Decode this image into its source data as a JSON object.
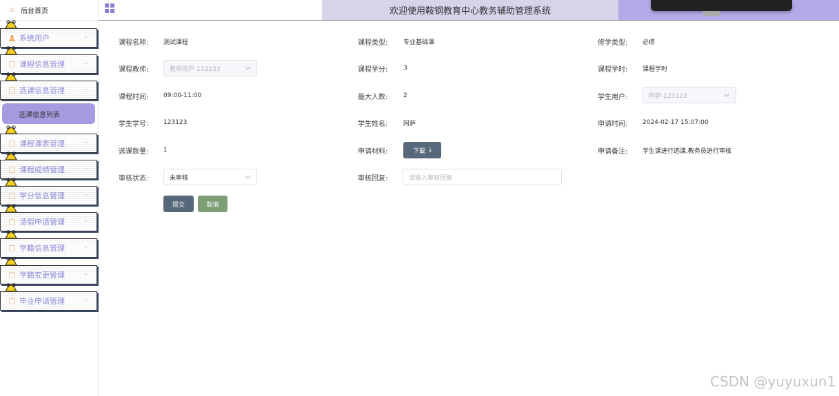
{
  "sidebar": {
    "home_label": "后台首页",
    "items": [
      {
        "label": "系统用户",
        "icon": "user-icon"
      },
      {
        "label": "课程信息管理",
        "icon": "doc-icon"
      },
      {
        "label": "选课信息管理",
        "icon": "doc-icon"
      },
      {
        "label": "课程课表管理",
        "icon": "doc-icon"
      },
      {
        "label": "课程成绩管理",
        "icon": "doc-icon"
      },
      {
        "label": "学分信息管理",
        "icon": "doc-icon"
      },
      {
        "label": "请假申请管理",
        "icon": "doc-icon"
      },
      {
        "label": "学籍信息管理",
        "icon": "doc-icon"
      },
      {
        "label": "学籍变更管理",
        "icon": "doc-icon"
      },
      {
        "label": "毕业申请管理",
        "icon": "doc-icon"
      }
    ],
    "submenu_active": "选课信息列表"
  },
  "header": {
    "title": "欢迎使用鞍钢教育中心教务辅助管理系统"
  },
  "form": {
    "course_name": {
      "label": "课程名称:",
      "value": "测试课程"
    },
    "course_type": {
      "label": "课程类型:",
      "value": "专业基础课"
    },
    "study_type": {
      "label": "修学类型:",
      "value": "必修"
    },
    "teacher": {
      "label": "课程教师:",
      "value": "教师用户-112233"
    },
    "credit": {
      "label": "课程学分:",
      "value": "3"
    },
    "hours": {
      "label": "课程学时:",
      "value": "课程学时"
    },
    "time": {
      "label": "课程时间:",
      "value": "09:00-11:00"
    },
    "max_people": {
      "label": "最大人数:",
      "value": "2"
    },
    "student_user": {
      "label": "学生用户:",
      "value": "阿萨-123123"
    },
    "student_id": {
      "label": "学生学号:",
      "value": "123123"
    },
    "student_name": {
      "label": "学生姓名:",
      "value": "阿萨"
    },
    "apply_time": {
      "label": "申请时间:",
      "value": "2024-02-17 15:07:00"
    },
    "count": {
      "label": "选课数量:",
      "value": "1"
    },
    "material": {
      "label": "申请材料:",
      "button": "下载"
    },
    "remark": {
      "label": "申请备注:",
      "value": "学生课进行选课,教务员进行审核"
    },
    "status": {
      "label": "审核状态:",
      "value": "未审核"
    },
    "reply": {
      "label": "审核回复:",
      "placeholder": "请输入审核回复"
    }
  },
  "buttons": {
    "submit": "提交",
    "cancel": "取消"
  },
  "watermark": "CSDN @yuyuxun1",
  "colors": {
    "accent_purple": "#a89ae0",
    "header_banner": "#d9d3ea",
    "button_dark": "#56687a",
    "button_green": "#7e9e76"
  }
}
